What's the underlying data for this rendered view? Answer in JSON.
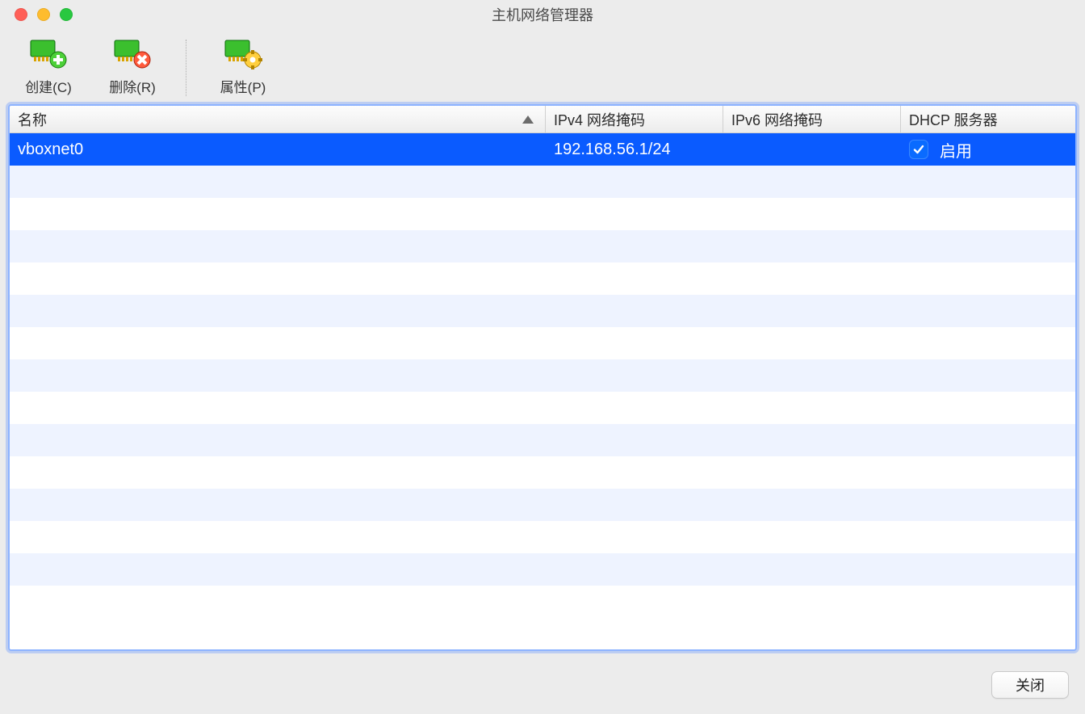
{
  "window": {
    "title": "主机网络管理器"
  },
  "toolbar": {
    "create_label": "创建(C)",
    "remove_label": "删除(R)",
    "properties_label": "属性(P)"
  },
  "table": {
    "headers": {
      "name": "名称",
      "ipv4": "IPv4 网络掩码",
      "ipv6": "IPv6 网络掩码",
      "dhcp": "DHCP 服务器"
    },
    "sorted_by": "name",
    "sort_dir": "asc",
    "rows": [
      {
        "name": "vboxnet0",
        "ipv4": "192.168.56.1/24",
        "ipv6": "",
        "dhcp_enabled": true,
        "dhcp_label": "启用",
        "selected": true
      }
    ],
    "empty_row_count": 14
  },
  "footer": {
    "close_label": "关闭"
  }
}
